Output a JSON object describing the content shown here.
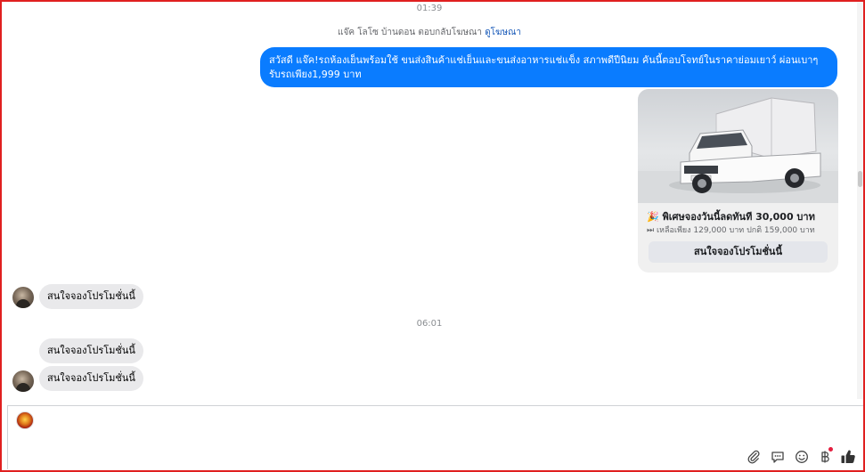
{
  "timestamps": [
    "01:39",
    "06:01"
  ],
  "ad_note": {
    "text": "แจ๊ค โลโซ บ้านดอน ตอบกลับโฆษณา",
    "link": "ดูโฆษณา"
  },
  "outgoing_message": "สวัสดี แจ๊ค!รถห้องเย็นพร้อมใช้ ขนส่งสินค้าแช่เย็นและขนส่งอาหารแช่แข็ง สภาพดีปีนิยม คันนี้ตอบโจทย์ในราคาย่อมเยาว์ ผ่อนเบาๆ รับรถเพียง1,999 บาท",
  "ad_card": {
    "title": "🎉 พิเศษจองวันนี้ลดทันที 30,000 บาท",
    "subtitle": "⏭ เหลือเพียง 129,000 บาท ปกติ 159,000 บาท",
    "button": "สนใจจองโปรโมชั่นนี้"
  },
  "incoming_messages": [
    "สนใจจองโปรโมชั่นนี้",
    "สนใจจองโปรโมชั่นนี้",
    "สนใจจองโปรโมชั่นนี้"
  ],
  "composer": {
    "value": "",
    "placeholder": ""
  },
  "toolbar_icons": [
    "paperclip-icon",
    "quick-reply-icon",
    "emoji-icon",
    "baht-payment-icon",
    "thumbs-up-icon"
  ],
  "colors": {
    "outgoing_bubble": "#0a7cff",
    "incoming_bubble": "#e9e9eb",
    "link": "#1658b8",
    "frame": "#e02020"
  }
}
